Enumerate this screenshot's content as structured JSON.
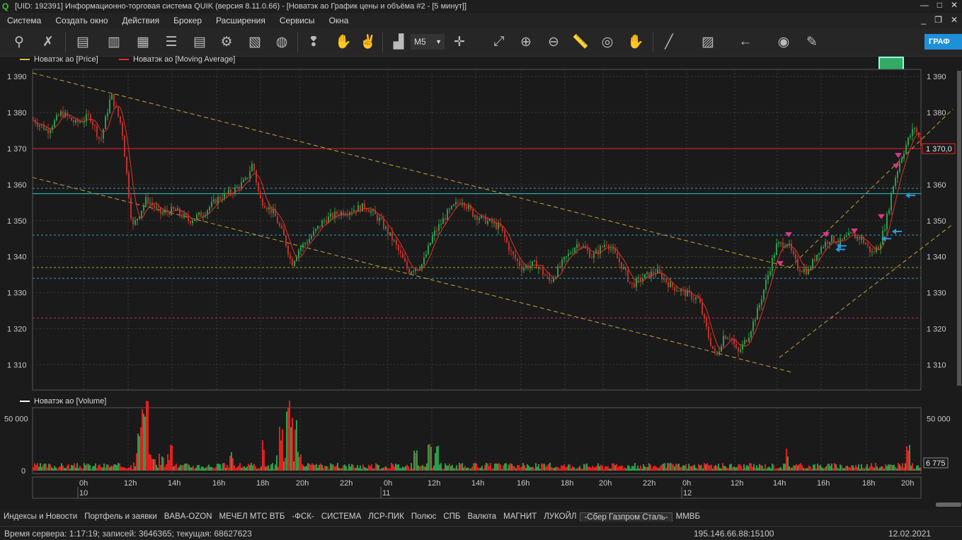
{
  "titlebar": {
    "title": "[UID: 192391] Информационно-торговая система QUIK (версия 8.11.0.66) - [Новатэк ао График цены и объёма #2 - [5 минут]]"
  },
  "menu": [
    "Система",
    "Создать окно",
    "Действия",
    "Брокер",
    "Расширения",
    "Сервисы",
    "Окна"
  ],
  "toolbar": {
    "interval": "M5",
    "graf_label": "ГРАФ"
  },
  "legend": {
    "price": "Новатэк ао [Price]",
    "ma": "Новатэк ао [Moving Average]",
    "volume": "Новатэк ао [Volume]",
    "price_color": "#d6b84a",
    "ma_color": "#e03030"
  },
  "price_axis": {
    "ticks": [
      "1 390",
      "1 380",
      "1 370",
      "1 360",
      "1 350",
      "1 340",
      "1 330",
      "1 320",
      "1 310"
    ],
    "current_label": "1 370,0"
  },
  "volume_axis": {
    "ticks_left": [
      "50 000",
      "0"
    ],
    "ticks_right": [
      "50 000"
    ],
    "current_label": "6 775"
  },
  "time_axis": {
    "hours": [
      "0h",
      "12h",
      "14h",
      "16h",
      "18h",
      "20h",
      "22h",
      "0h",
      "12h",
      "14h",
      "16h",
      "18h",
      "20h",
      "22h",
      "0h",
      "12h",
      "14h",
      "16h",
      "18h",
      "20h"
    ],
    "days": [
      "10",
      "11",
      "12"
    ]
  },
  "tabs": [
    "Индексы и Новости",
    "Портфель и заявки",
    "BABA-OZON",
    "МЕЧЕЛ МТС ВТБ",
    "-ФСК-",
    "СИСТЕМА",
    "ЛСР-ПИК",
    "Полюс",
    "СПБ",
    "Валюта",
    "МАГНИТ",
    "ЛУКОЙЛ",
    "-Сбер Газпром Сталь-",
    "ММВБ"
  ],
  "active_tab": "-Сбер Газпром Сталь-",
  "status": {
    "server": "Время сервера: 1:17:19; записей: 3646365; текущая: 68627623",
    "ip": "195.146.66.88:15100",
    "date": "12.02.2021"
  },
  "chart_data": {
    "type": "candlestick",
    "instrument": "Новатэк ао",
    "interval": "5 минут",
    "ylim": [
      1303,
      1392
    ],
    "levels": [
      {
        "price": 1370,
        "color": "#e02828",
        "style": "solid"
      },
      {
        "price": 1359,
        "color": "#2e9ec8",
        "style": "dashed"
      },
      {
        "price": 1357.5,
        "color": "#2ec8c8",
        "style": "solid"
      },
      {
        "price": 1346,
        "color": "#2e9ec8",
        "style": "dashed"
      },
      {
        "price": 1337,
        "color": "#9aa82e",
        "style": "dashed"
      },
      {
        "price": 1334,
        "color": "#2e9ec8",
        "style": "dashed"
      },
      {
        "price": 1323,
        "color": "#c02a6a",
        "style": "dashed"
      }
    ],
    "trendlines": [
      {
        "from": [
          0,
          1391
        ],
        "to": [
          1071,
          1337
        ],
        "color": "#c8a040"
      },
      {
        "from": [
          0,
          1362
        ],
        "to": [
          1071,
          1308
        ],
        "color": "#c8a040"
      },
      {
        "from": [
          1055,
          1312
        ],
        "to": [
          1300,
          1349
        ],
        "color": "#c8a040"
      },
      {
        "from": [
          1070,
          1337
        ],
        "to": [
          1300,
          1381
        ],
        "color": "#c8a040"
      }
    ],
    "price_path": [
      [
        0,
        1378
      ],
      [
        20,
        1375
      ],
      [
        40,
        1380
      ],
      [
        60,
        1377
      ],
      [
        80,
        1379
      ],
      [
        95,
        1372
      ],
      [
        110,
        1385
      ],
      [
        125,
        1376
      ],
      [
        140,
        1348
      ],
      [
        160,
        1356
      ],
      [
        180,
        1352
      ],
      [
        200,
        1353
      ],
      [
        220,
        1350
      ],
      [
        240,
        1352
      ],
      [
        260,
        1356
      ],
      [
        280,
        1358
      ],
      [
        300,
        1361
      ],
      [
        310,
        1366
      ],
      [
        320,
        1356
      ],
      [
        340,
        1352
      ],
      [
        355,
        1345
      ],
      [
        365,
        1338
      ],
      [
        375,
        1342
      ],
      [
        390,
        1345
      ],
      [
        410,
        1350
      ],
      [
        430,
        1352
      ],
      [
        450,
        1353
      ],
      [
        470,
        1354
      ],
      [
        490,
        1350
      ],
      [
        510,
        1344
      ],
      [
        530,
        1336
      ],
      [
        550,
        1338
      ],
      [
        565,
        1346
      ],
      [
        585,
        1352
      ],
      [
        605,
        1356
      ],
      [
        620,
        1352
      ],
      [
        640,
        1350
      ],
      [
        660,
        1348
      ],
      [
        675,
        1341
      ],
      [
        690,
        1337
      ],
      [
        710,
        1338
      ],
      [
        730,
        1333
      ],
      [
        750,
        1339
      ],
      [
        770,
        1344
      ],
      [
        790,
        1340
      ],
      [
        810,
        1344
      ],
      [
        830,
        1338
      ],
      [
        845,
        1332
      ],
      [
        860,
        1334
      ],
      [
        880,
        1336
      ],
      [
        900,
        1332
      ],
      [
        920,
        1330
      ],
      [
        940,
        1328
      ],
      [
        955,
        1317
      ],
      [
        965,
        1312
      ],
      [
        975,
        1318
      ],
      [
        985,
        1318
      ],
      [
        995,
        1313
      ],
      [
        1010,
        1318
      ],
      [
        1025,
        1326
      ],
      [
        1035,
        1333
      ],
      [
        1050,
        1343
      ],
      [
        1065,
        1344
      ],
      [
        1080,
        1337
      ],
      [
        1095,
        1336
      ],
      [
        1110,
        1342
      ],
      [
        1125,
        1345
      ],
      [
        1140,
        1344
      ],
      [
        1155,
        1346
      ],
      [
        1170,
        1345
      ],
      [
        1185,
        1341
      ],
      [
        1195,
        1343
      ],
      [
        1205,
        1350
      ],
      [
        1215,
        1360
      ],
      [
        1225,
        1367
      ],
      [
        1235,
        1372
      ],
      [
        1245,
        1376
      ],
      [
        1255,
        1371
      ]
    ],
    "sell_markers": [
      [
        1056,
        1338
      ],
      [
        1068,
        1346
      ],
      [
        1121,
        1346
      ],
      [
        1161,
        1347
      ],
      [
        1199,
        1351
      ],
      [
        1220,
        1365
      ],
      [
        1223,
        1368
      ]
    ],
    "buy_markers": [
      [
        1134,
        1342
      ],
      [
        1136,
        1343
      ],
      [
        1199,
        1345
      ],
      [
        1214,
        1347
      ],
      [
        1233,
        1357
      ]
    ],
    "volume_ylim": [
      0,
      58000
    ],
    "volume_spikes": [
      [
        150,
        42000
      ],
      [
        155,
        58000
      ],
      [
        160,
        58000
      ],
      [
        195,
        25000
      ],
      [
        280,
        18000
      ],
      [
        325,
        30000
      ],
      [
        350,
        36000
      ],
      [
        360,
        58000
      ],
      [
        365,
        50000
      ],
      [
        371,
        58000
      ],
      [
        540,
        22000
      ],
      [
        560,
        29000
      ],
      [
        570,
        28000
      ],
      [
        1065,
        22000
      ],
      [
        1236,
        32000
      ],
      [
        1260,
        58000
      ],
      [
        1265,
        40000
      ]
    ]
  }
}
